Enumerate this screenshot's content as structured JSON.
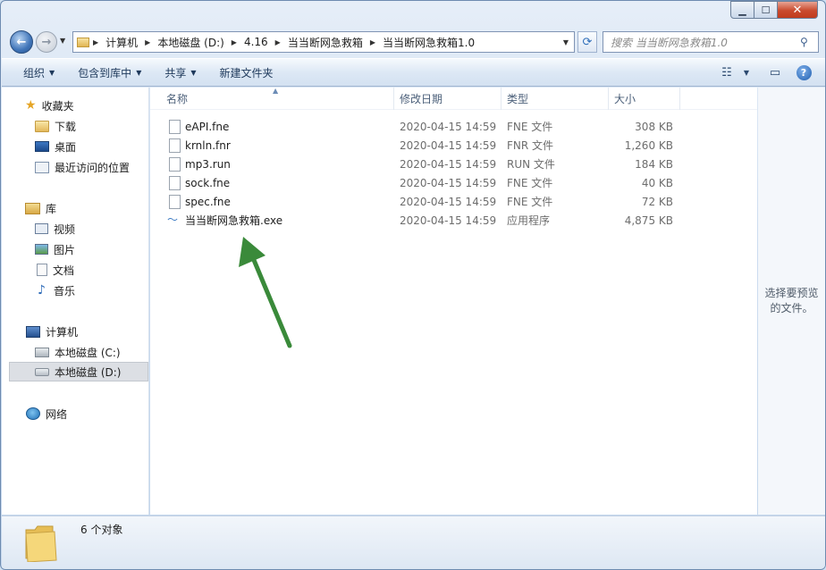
{
  "address": {
    "crumbs": [
      "计算机",
      "本地磁盘 (D:)",
      "4.16",
      "当当断网急救箱",
      "当当断网急救箱1.0"
    ]
  },
  "search": {
    "placeholder": "搜索 当当断网急救箱1.0"
  },
  "toolbar": {
    "organize": "组织",
    "include_library": "包含到库中",
    "share": "共享",
    "new_folder": "新建文件夹"
  },
  "sidebar": {
    "favorites": {
      "label": "收藏夹",
      "items": [
        "下载",
        "桌面",
        "最近访问的位置"
      ]
    },
    "libraries": {
      "label": "库",
      "items": [
        "视频",
        "图片",
        "文档",
        "音乐"
      ]
    },
    "computer": {
      "label": "计算机",
      "items": [
        "本地磁盘 (C:)",
        "本地磁盘 (D:)"
      ],
      "selected": "本地磁盘 (D:)"
    },
    "network": {
      "label": "网络"
    }
  },
  "columns": {
    "name": "名称",
    "date": "修改日期",
    "type": "类型",
    "size": "大小"
  },
  "files": [
    {
      "name": "eAPI.fne",
      "date": "2020-04-15 14:59",
      "type": "FNE 文件",
      "size": "308 KB",
      "icon": "file-icon"
    },
    {
      "name": "krnln.fnr",
      "date": "2020-04-15 14:59",
      "type": "FNR 文件",
      "size": "1,260 KB",
      "icon": "file-icon"
    },
    {
      "name": "mp3.run",
      "date": "2020-04-15 14:59",
      "type": "RUN 文件",
      "size": "184 KB",
      "icon": "file-icon"
    },
    {
      "name": "sock.fne",
      "date": "2020-04-15 14:59",
      "type": "FNE 文件",
      "size": "40 KB",
      "icon": "file-icon"
    },
    {
      "name": "spec.fne",
      "date": "2020-04-15 14:59",
      "type": "FNE 文件",
      "size": "72 KB",
      "icon": "file-icon"
    },
    {
      "name": "当当断网急救箱.exe",
      "date": "2020-04-15 14:59",
      "type": "应用程序",
      "size": "4,875 KB",
      "icon": "exe-icon"
    }
  ],
  "preview": {
    "text": "选择要预览的文件。"
  },
  "status": {
    "count": "6 个对象"
  },
  "colors": {
    "annotation_arrow": "#3a8a3a",
    "selection": "#dcdfe4"
  }
}
